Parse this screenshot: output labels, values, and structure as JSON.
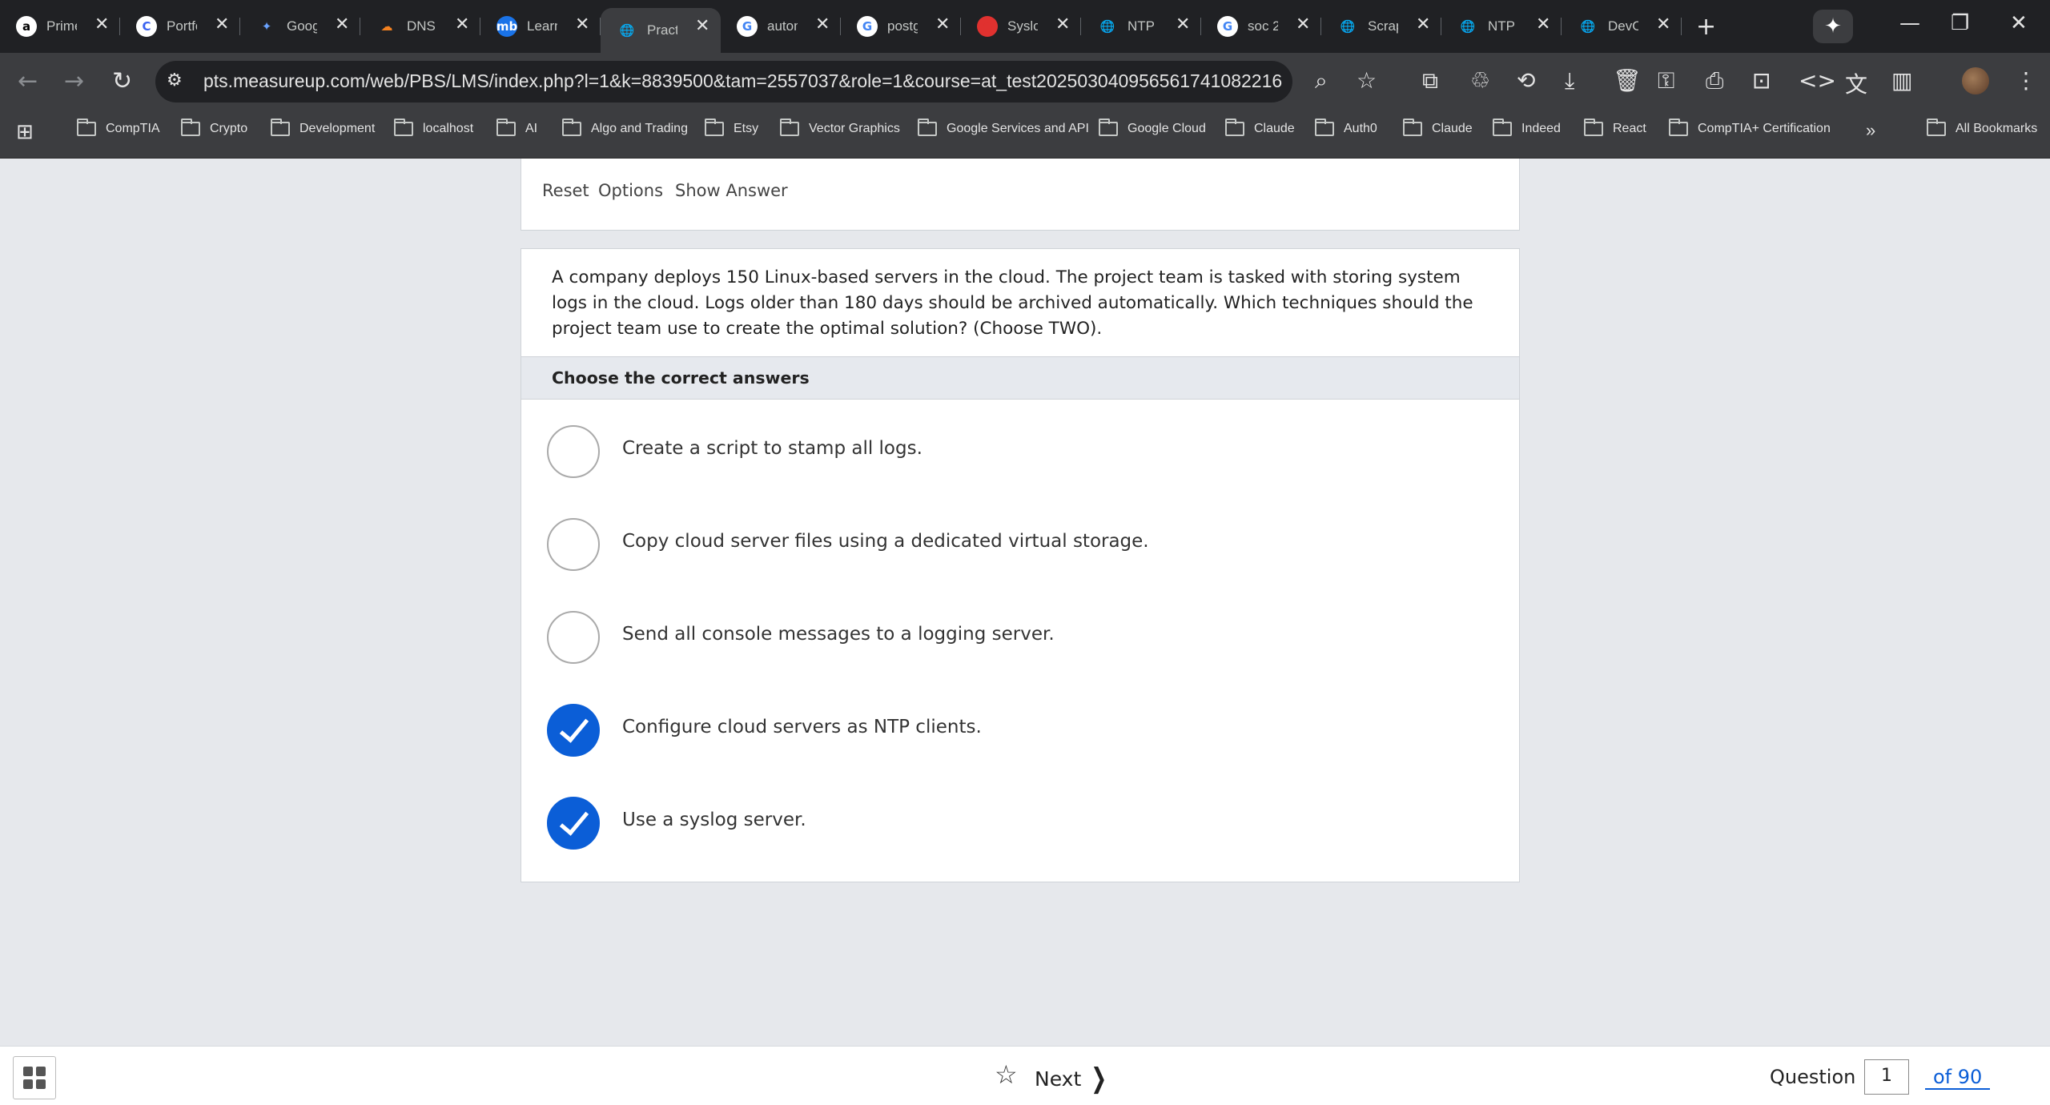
{
  "browser": {
    "tabs": [
      {
        "title": "Prime",
        "favicon": "a",
        "favicon_bg": "#ffffff",
        "favicon_fg": "#000000"
      },
      {
        "title": "Portfolio",
        "favicon": "C",
        "favicon_bg": "#ffffff",
        "favicon_fg": "#3a62f0"
      },
      {
        "title": "Google",
        "favicon": "✦",
        "favicon_bg": "transparent",
        "favicon_fg": "#6aa3ff"
      },
      {
        "title": "DNS",
        "favicon": "☁",
        "favicon_bg": "transparent",
        "favicon_fg": "#f48120"
      },
      {
        "title": "Learn",
        "favicon": "mb",
        "favicon_bg": "#1a73e8",
        "favicon_fg": "#ffffff"
      },
      {
        "title": "Practice",
        "favicon": "🌐",
        "favicon_bg": "transparent",
        "favicon_fg": "#c4c7c5",
        "active": true
      },
      {
        "title": "autom",
        "favicon": "G",
        "favicon_bg": "#ffffff",
        "favicon_fg": "#4285f4"
      },
      {
        "title": "postgres",
        "favicon": "G",
        "favicon_bg": "#ffffff",
        "favicon_fg": "#4285f4"
      },
      {
        "title": "Syslog",
        "favicon": "●",
        "favicon_bg": "#e0312f",
        "favicon_fg": "#e0312f"
      },
      {
        "title": "NTP",
        "favicon": "🌐",
        "favicon_bg": "transparent",
        "favicon_fg": "#c4c7c5"
      },
      {
        "title": "soc 2",
        "favicon": "G",
        "favicon_bg": "#ffffff",
        "favicon_fg": "#4285f4"
      },
      {
        "title": "Scrap",
        "favicon": "🌐",
        "favicon_bg": "transparent",
        "favicon_fg": "#c4c7c5"
      },
      {
        "title": "NTP",
        "favicon": "🌐",
        "favicon_bg": "transparent",
        "favicon_fg": "#c4c7c5"
      },
      {
        "title": "DevOps",
        "favicon": "🌐",
        "favicon_bg": "transparent",
        "favicon_fg": "#c4c7c5"
      }
    ],
    "url": "pts.measureup.com/web/PBS/LMS/index.php?l=1&k=8839500&tam=2557037&role=1&course=at_test20250304095656174108221​6",
    "bookmarks": [
      "CompTIA",
      "Crypto",
      "Development",
      "localhost",
      "AI",
      "Algo and Trading",
      "Etsy",
      "Vector Graphics",
      "Google Services and API",
      "Google Cloud",
      "Claude",
      "Auth0",
      "Claude",
      "Indeed",
      "React",
      "CompTIA+ Certification"
    ],
    "all_bookmarks": "All Bookmarks"
  },
  "actions": {
    "reset": "Reset",
    "options": "Options",
    "show_answer": "Show Answer"
  },
  "question": {
    "text": "A company deploys 150 Linux-based servers in the cloud. The project team is tasked with storing system logs in the cloud. Logs older than 180 days should be archived automatically. Which techniques should the project team use to create the optimal solution? (Choose TWO).",
    "instruction": "Choose the correct answers",
    "options": [
      {
        "label": "Create a script to stamp all logs.",
        "checked": false
      },
      {
        "label": "Copy cloud server files using a dedicated virtual storage.",
        "checked": false
      },
      {
        "label": "Send all console messages to a logging server.",
        "checked": false
      },
      {
        "label": "Configure cloud servers as NTP clients.",
        "checked": true
      },
      {
        "label": "Use a syslog server.",
        "checked": true
      }
    ]
  },
  "footer": {
    "next_label": "Next",
    "question_label": "Question",
    "question_number": "1",
    "total_label": "of 90"
  },
  "colors": {
    "accent": "#0b5ed7",
    "page_bg": "#e6e8ec"
  }
}
